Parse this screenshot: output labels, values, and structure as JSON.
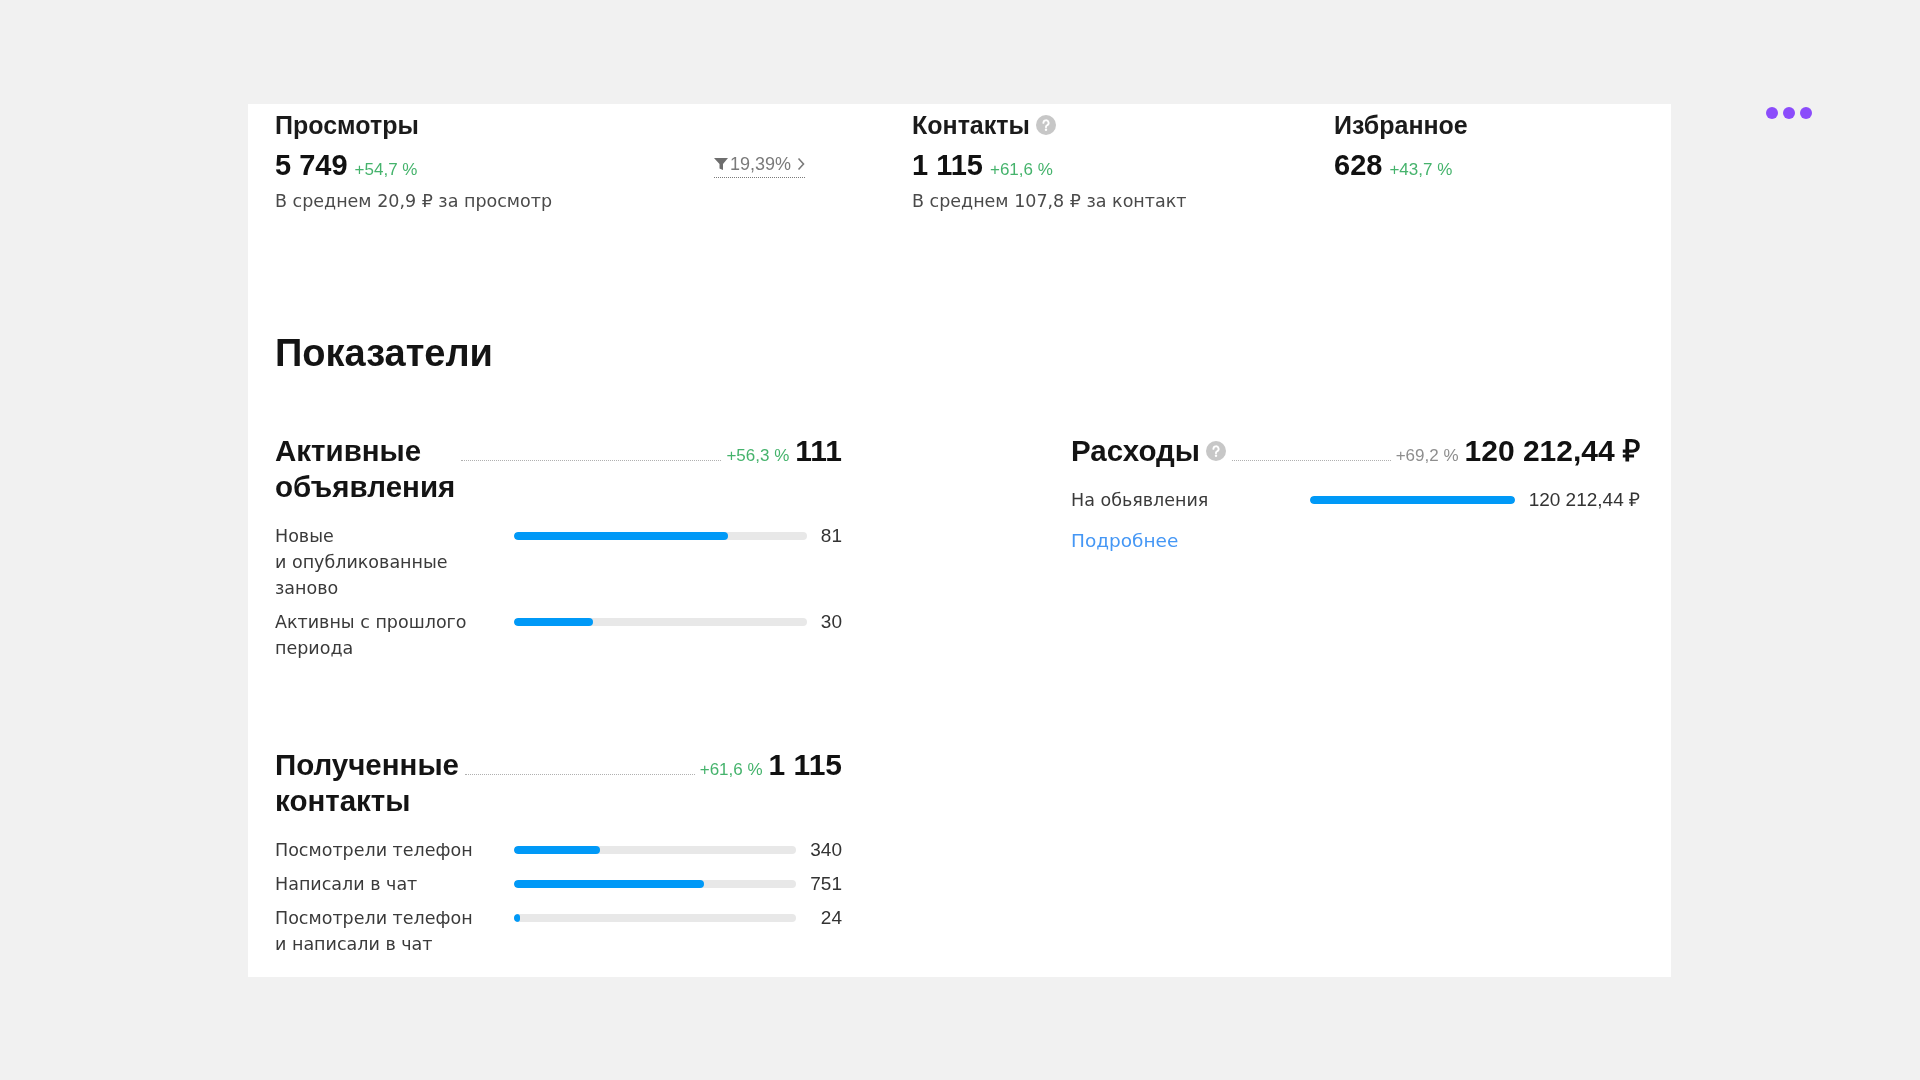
{
  "stats": [
    {
      "title": "Просмотры",
      "help": false,
      "value": "5 749",
      "change": {
        "text": "+54,7 %",
        "positive": true
      },
      "conversion": "19,39%",
      "average": "В среднем 20,9 ₽ за просмотр"
    },
    {
      "title": "Контакты",
      "help": true,
      "value": "1 115",
      "change": {
        "text": "+61,6 %",
        "positive": true
      },
      "average": "В среднем 107,8 ₽ за контакт"
    },
    {
      "title": "Избранное",
      "help": false,
      "value": "628",
      "change": {
        "text": "+43,7 %",
        "positive": true
      }
    }
  ],
  "indicators": {
    "title": "Показатели",
    "columns": [
      {
        "sections": [
          {
            "title": "Активные объявления",
            "help": false,
            "change": {
              "text": "+56,3 %",
              "positive": true
            },
            "value": "111",
            "rows": [
              {
                "label": "Новые и опубликованные заново",
                "level": 0.73,
                "value": "81"
              },
              {
                "label": "Активны с прошлого периода",
                "level": 0.27,
                "value": "30"
              }
            ]
          },
          {
            "title": "Полученные контакты",
            "help": false,
            "change": {
              "text": "+61,6 %",
              "positive": true
            },
            "value": "1 115",
            "rows": [
              {
                "label": "Посмотрели телефон",
                "level": 0.305,
                "value": "340"
              },
              {
                "label": "Написали в чат",
                "level": 0.674,
                "value": "751"
              },
              {
                "label": "Посмотрели телефон и написали в чат",
                "level": 0.022,
                "value": "24"
              }
            ]
          }
        ]
      },
      {
        "sections": [
          {
            "title": "Расходы",
            "help": true,
            "change": {
              "text": "+69,2 %",
              "positive": false
            },
            "value": "120 212,44 ₽",
            "rows": [
              {
                "label": "На обьявления",
                "level": 1,
                "value": "120 212,44 ₽"
              }
            ],
            "link": "Подробнее"
          }
        ]
      }
    ]
  }
}
